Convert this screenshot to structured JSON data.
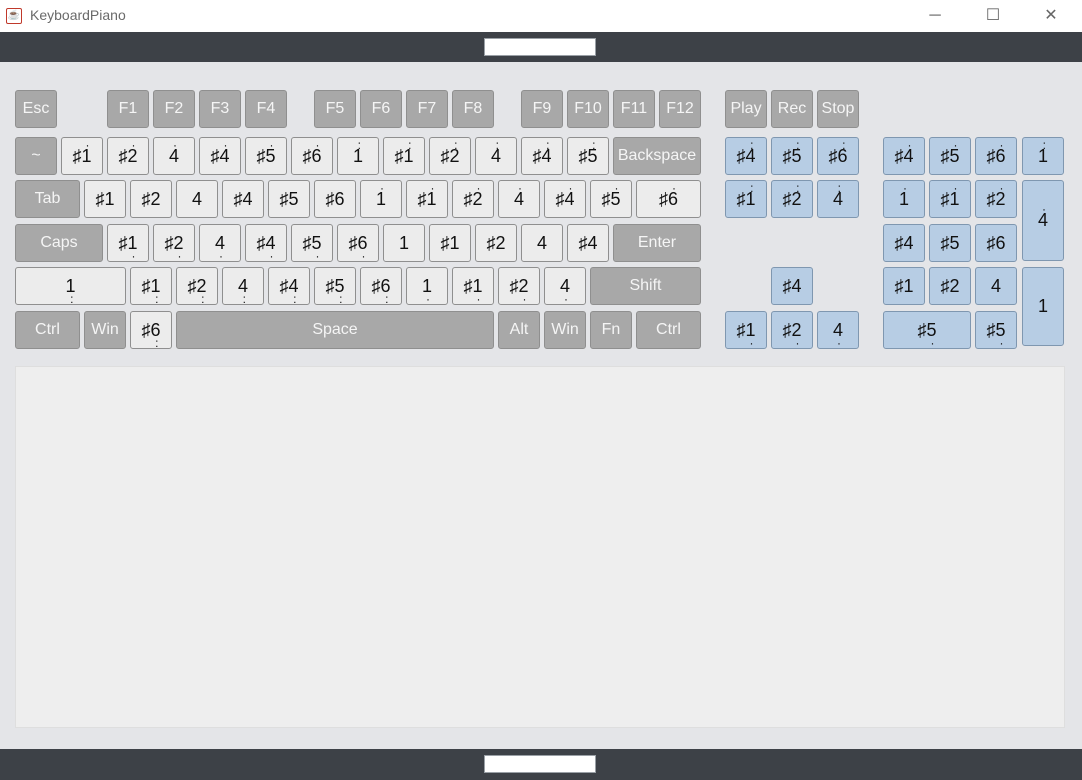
{
  "window": {
    "title": "KeyboardPiano",
    "minimize": "─",
    "maximize": "☐",
    "close": "✕"
  },
  "top_field": "",
  "bottom_field": "",
  "output_text": "",
  "icons": {
    "app": "java-icon"
  },
  "colors": {
    "gray_key": "#a8a8a8",
    "white_key": "#ececec",
    "blue_key": "#b7cde4",
    "bar": "#3d4147"
  },
  "keys": [
    {
      "id": "esc",
      "label": "Esc",
      "t": "gray"
    },
    {
      "id": "f1",
      "label": "F1",
      "t": "gray"
    },
    {
      "id": "f2",
      "label": "F2",
      "t": "gray"
    },
    {
      "id": "f3",
      "label": "F3",
      "t": "gray"
    },
    {
      "id": "f4",
      "label": "F4",
      "t": "gray"
    },
    {
      "id": "f5",
      "label": "F5",
      "t": "gray"
    },
    {
      "id": "f6",
      "label": "F6",
      "t": "gray"
    },
    {
      "id": "f7",
      "label": "F7",
      "t": "gray"
    },
    {
      "id": "f8",
      "label": "F8",
      "t": "gray"
    },
    {
      "id": "f9",
      "label": "F9",
      "t": "gray"
    },
    {
      "id": "f10",
      "label": "F10",
      "t": "gray"
    },
    {
      "id": "f11",
      "label": "F11",
      "t": "gray"
    },
    {
      "id": "f12",
      "label": "F12",
      "t": "gray"
    },
    {
      "id": "play",
      "label": "Play",
      "t": "gray"
    },
    {
      "id": "rec",
      "label": "Rec",
      "t": "gray"
    },
    {
      "id": "stop",
      "label": "Stop",
      "t": "gray"
    },
    {
      "id": "tilde",
      "label": "~",
      "t": "gray"
    },
    {
      "id": "n1",
      "label": "♯1",
      "d": "1",
      "t": "white"
    },
    {
      "id": "n2",
      "label": "♯2",
      "d": "1",
      "t": "white"
    },
    {
      "id": "n3",
      "label": "4",
      "d": "1",
      "t": "white"
    },
    {
      "id": "n4",
      "label": "♯4",
      "d": "1",
      "t": "white"
    },
    {
      "id": "n5",
      "label": "♯5",
      "d": "1",
      "t": "white"
    },
    {
      "id": "n6",
      "label": "♯6",
      "d": "1",
      "t": "white"
    },
    {
      "id": "n7",
      "label": "1",
      "d": "2",
      "t": "white"
    },
    {
      "id": "n8",
      "label": "♯1",
      "d": "2",
      "t": "white"
    },
    {
      "id": "n9",
      "label": "♯2",
      "d": "2",
      "t": "white"
    },
    {
      "id": "n0",
      "label": "4",
      "d": "2",
      "t": "white"
    },
    {
      "id": "nminus",
      "label": "♯4",
      "d": "2",
      "t": "white"
    },
    {
      "id": "nequal",
      "label": "♯5",
      "d": "2",
      "t": "white"
    },
    {
      "id": "backspace",
      "label": "Backspace",
      "t": "gray"
    },
    {
      "id": "ins",
      "label": "♯4",
      "d": "2",
      "t": "blue"
    },
    {
      "id": "home",
      "label": "♯5",
      "d": "2",
      "t": "blue"
    },
    {
      "id": "pgup",
      "label": "♯6",
      "d": "2",
      "t": "blue"
    },
    {
      "id": "numlock",
      "label": "♯4",
      "d": "1",
      "t": "blue"
    },
    {
      "id": "numdiv",
      "label": "♯5",
      "d": "1",
      "t": "blue"
    },
    {
      "id": "nummul",
      "label": "♯6",
      "d": "1",
      "t": "blue"
    },
    {
      "id": "numsub",
      "label": "1",
      "d": "2",
      "t": "blue"
    },
    {
      "id": "tab",
      "label": "Tab",
      "t": "gray"
    },
    {
      "id": "q",
      "label": "♯1",
      "t": "white"
    },
    {
      "id": "w",
      "label": "♯2",
      "t": "white"
    },
    {
      "id": "e",
      "label": "4",
      "t": "white"
    },
    {
      "id": "r",
      "label": "♯4",
      "t": "white"
    },
    {
      "id": "t",
      "label": "♯5",
      "t": "white"
    },
    {
      "id": "y",
      "label": "♯6",
      "t": "white"
    },
    {
      "id": "u",
      "label": "1",
      "d": "1",
      "t": "white"
    },
    {
      "id": "i",
      "label": "♯1",
      "d": "1",
      "t": "white"
    },
    {
      "id": "o",
      "label": "♯2",
      "d": "1",
      "t": "white"
    },
    {
      "id": "p",
      "label": "4",
      "d": "1",
      "t": "white"
    },
    {
      "id": "lbr",
      "label": "♯4",
      "d": "1",
      "t": "white"
    },
    {
      "id": "rbr",
      "label": "♯5",
      "d": "1",
      "t": "white"
    },
    {
      "id": "bslash",
      "label": "♯6",
      "d": "1",
      "t": "white"
    },
    {
      "id": "del",
      "label": "♯1",
      "d": "2",
      "t": "blue"
    },
    {
      "id": "end",
      "label": "♯2",
      "d": "2",
      "t": "blue"
    },
    {
      "id": "pgdn",
      "label": "4",
      "d": "2",
      "t": "blue"
    },
    {
      "id": "num7",
      "label": "1",
      "d": "1",
      "t": "blue"
    },
    {
      "id": "num8",
      "label": "♯1",
      "d": "1",
      "t": "blue"
    },
    {
      "id": "num9",
      "label": "♯2",
      "d": "1",
      "t": "blue"
    },
    {
      "id": "numadd",
      "label": "4",
      "d": "1",
      "t": "blue"
    },
    {
      "id": "caps",
      "label": "Caps",
      "t": "gray"
    },
    {
      "id": "a",
      "label": "♯1",
      "u": "1",
      "t": "white"
    },
    {
      "id": "s",
      "label": "♯2",
      "u": "1",
      "t": "white"
    },
    {
      "id": "d",
      "label": "4",
      "u": "1",
      "t": "white"
    },
    {
      "id": "f",
      "label": "♯4",
      "u": "1",
      "t": "white"
    },
    {
      "id": "g",
      "label": "♯5",
      "u": "1",
      "t": "white"
    },
    {
      "id": "h",
      "label": "♯6",
      "u": "1",
      "t": "white"
    },
    {
      "id": "j",
      "label": "1",
      "t": "white"
    },
    {
      "id": "k",
      "label": "♯1",
      "t": "white"
    },
    {
      "id": "l",
      "label": "♯2",
      "t": "white"
    },
    {
      "id": "semi",
      "label": "4",
      "t": "white"
    },
    {
      "id": "quote",
      "label": "♯4",
      "t": "white"
    },
    {
      "id": "enter",
      "label": "Enter",
      "t": "gray"
    },
    {
      "id": "num4",
      "label": "♯4",
      "t": "blue"
    },
    {
      "id": "num5",
      "label": "♯5",
      "t": "blue"
    },
    {
      "id": "num6",
      "label": "♯6",
      "t": "blue"
    },
    {
      "id": "lshift",
      "label": "1",
      "u": "2",
      "t": "white"
    },
    {
      "id": "z",
      "label": "♯1",
      "u": "2",
      "t": "white"
    },
    {
      "id": "x",
      "label": "♯2",
      "u": "2",
      "t": "white"
    },
    {
      "id": "c",
      "label": "4",
      "u": "2",
      "t": "white"
    },
    {
      "id": "v",
      "label": "♯4",
      "u": "2",
      "t": "white"
    },
    {
      "id": "b",
      "label": "♯5",
      "u": "2",
      "t": "white"
    },
    {
      "id": "n",
      "label": "♯6",
      "u": "2",
      "t": "white"
    },
    {
      "id": "m",
      "label": "1",
      "u": "1",
      "t": "white"
    },
    {
      "id": "comma",
      "label": "♯1",
      "u": "1",
      "t": "white"
    },
    {
      "id": "period",
      "label": "♯2",
      "u": "1",
      "t": "white"
    },
    {
      "id": "slash",
      "label": "4",
      "u": "1",
      "t": "white"
    },
    {
      "id": "rshift",
      "label": "Shift",
      "t": "gray"
    },
    {
      "id": "up",
      "label": "♯4",
      "t": "blue"
    },
    {
      "id": "num1",
      "label": "♯1",
      "t": "blue"
    },
    {
      "id": "num2",
      "label": "♯2",
      "t": "blue"
    },
    {
      "id": "num3",
      "label": "4",
      "t": "blue"
    },
    {
      "id": "numenter",
      "label": "1",
      "t": "blue"
    },
    {
      "id": "lctrl",
      "label": "Ctrl",
      "t": "gray"
    },
    {
      "id": "lwin",
      "label": "Win",
      "t": "gray"
    },
    {
      "id": "lalt",
      "label": "♯6",
      "u": "2",
      "t": "white"
    },
    {
      "id": "space",
      "label": "Space",
      "t": "gray"
    },
    {
      "id": "ralt",
      "label": "Alt",
      "t": "gray"
    },
    {
      "id": "rwin",
      "label": "Win",
      "t": "gray"
    },
    {
      "id": "fn",
      "label": "Fn",
      "t": "gray"
    },
    {
      "id": "rctrl",
      "label": "Ctrl",
      "t": "gray"
    },
    {
      "id": "left",
      "label": "♯1",
      "u": "1",
      "t": "blue"
    },
    {
      "id": "down",
      "label": "♯2",
      "u": "1",
      "t": "blue"
    },
    {
      "id": "right",
      "label": "4",
      "u": "1",
      "t": "blue"
    },
    {
      "id": "num0",
      "label": "♯5",
      "u": "1",
      "t": "blue"
    },
    {
      "id": "numdot",
      "label": "♯5",
      "u": "1",
      "t": "blue"
    }
  ]
}
